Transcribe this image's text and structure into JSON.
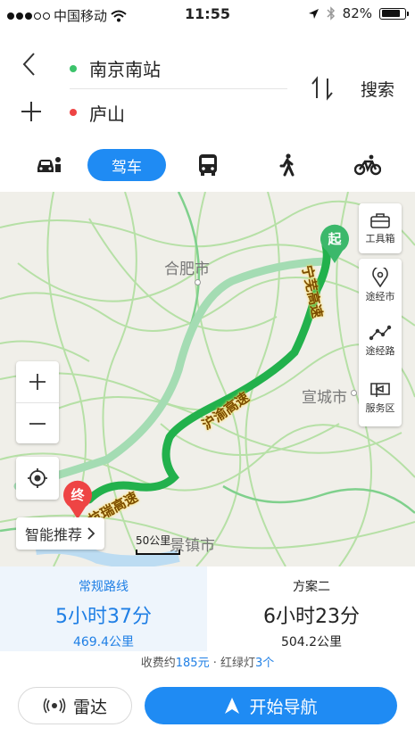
{
  "status_bar": {
    "carrier": "中国移动",
    "time": "11:55",
    "battery": "82%",
    "battery_level": 0.82
  },
  "route": {
    "start": "南京南站",
    "end": "庐山",
    "search_label": "搜索",
    "start_color": "#3cc36b",
    "end_color": "#ee4444"
  },
  "modes": [
    {
      "icon": "taxi-icon"
    },
    {
      "label": "驾车",
      "icon": "car-icon",
      "active": true
    },
    {
      "icon": "bus-icon"
    },
    {
      "icon": "walk-icon"
    },
    {
      "icon": "bike-icon"
    }
  ],
  "map": {
    "city_labels": [
      "合肥市",
      "宣城市",
      "景镇市"
    ],
    "highway_labels": [
      "宁芜高速",
      "沪渝高速",
      "杭瑞高速"
    ],
    "start_pin": "起",
    "end_pin": "终",
    "scale": "50公里",
    "recommend": "智能推荐",
    "tools": [
      {
        "label": "工具箱",
        "icon": "toolbox-icon"
      },
      {
        "label": "途经市",
        "icon": "pin-icon"
      },
      {
        "label": "途经路",
        "icon": "route-icon"
      },
      {
        "label": "服务区",
        "icon": "flag-icon"
      }
    ],
    "route_color": "#22b14c",
    "alt_route_color": "#9ad7a8"
  },
  "plans": [
    {
      "title": "常规路线",
      "duration": "5小时37分",
      "distance": "469.4公里",
      "selected": true
    },
    {
      "title": "方案二",
      "duration": "6小时23分",
      "distance": "504.2公里",
      "selected": false
    }
  ],
  "fees": {
    "prefix": "收费约",
    "amount": "185元",
    "mid": " · 红绿灯",
    "lights": "3个"
  },
  "buttons": {
    "radar": "雷达",
    "navigate": "开始导航"
  },
  "accent": "#1f8bf3"
}
